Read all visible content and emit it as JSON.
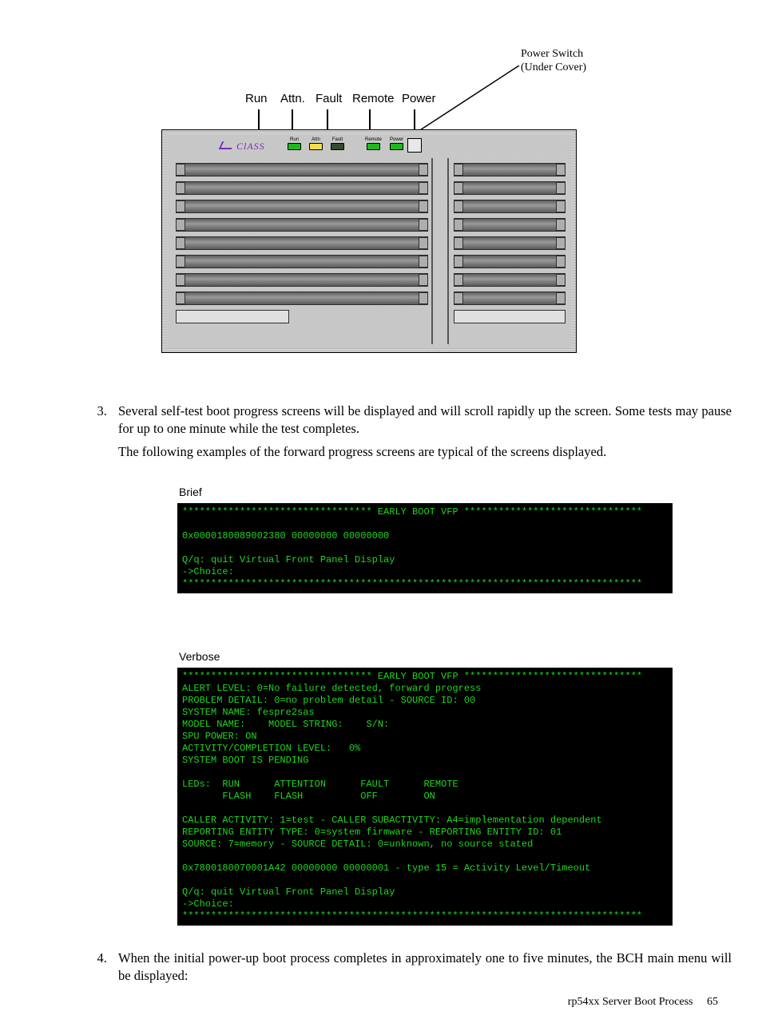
{
  "diagram": {
    "power_switch_l1": "Power Switch",
    "power_switch_l2": "(Under Cover)",
    "labels": {
      "run": "Run",
      "attn": "Attn.",
      "fault": "Fault",
      "remote": "Remote",
      "power": "Power"
    },
    "chassis_brand": "ClASS",
    "leds": {
      "run": {
        "caption": "Run",
        "color": "green"
      },
      "attn": {
        "caption": "Attn",
        "color": "yellow"
      },
      "fault": {
        "caption": "Fault",
        "color": "dark"
      },
      "remote": {
        "caption": "Remote",
        "color": "green"
      },
      "power": {
        "caption": "Power",
        "color": "green"
      }
    }
  },
  "steps": {
    "s3a": "Several self-test boot progress screens will be displayed and will scroll rapidly up the screen. Some tests may pause for up to one minute while the test completes.",
    "s3b": "The following examples of the forward progress screens are typical of the screens displayed.",
    "s4": "When the initial power-up boot process completes in approximately one to five minutes, the BCH main menu will be displayed:"
  },
  "terminals": {
    "brief_title": "Brief",
    "brief_text": "********************************* EARLY BOOT VFP *******************************\n\n0x0000180089002380 00000000 00000000\n\nQ/q: quit Virtual Front Panel Display\n->Choice:\n********************************************************************************",
    "verbose_title": "Verbose",
    "verbose_text": "********************************* EARLY BOOT VFP *******************************\nALERT LEVEL: 0=No failure detected, forward progress\nPROBLEM DETAIL: 0=no problem detail - SOURCE ID: 00\nSYSTEM NAME: fespre2sas\nMODEL NAME:    MODEL STRING:    S/N:\nSPU POWER: ON\nACTIVITY/COMPLETION LEVEL:   0%\nSYSTEM BOOT IS PENDING\n\nLEDs:  RUN      ATTENTION      FAULT      REMOTE\n       FLASH    FLASH          OFF        ON\n\nCALLER ACTIVITY: 1=test - CALLER SUBACTIVITY: A4=implementation dependent\nREPORTING ENTITY TYPE: 0=system firmware - REPORTING ENTITY ID: 01\nSOURCE: 7=memory - SOURCE DETAIL: 0=unknown, no source stated\n\n0x7800180070001A42 00000000 00000001 - type 15 = Activity Level/Timeout\n\nQ/q: quit Virtual Front Panel Display\n->Choice:\n********************************************************************************"
  },
  "footer": {
    "title": "rp54xx Server Boot Process",
    "page": "65"
  }
}
